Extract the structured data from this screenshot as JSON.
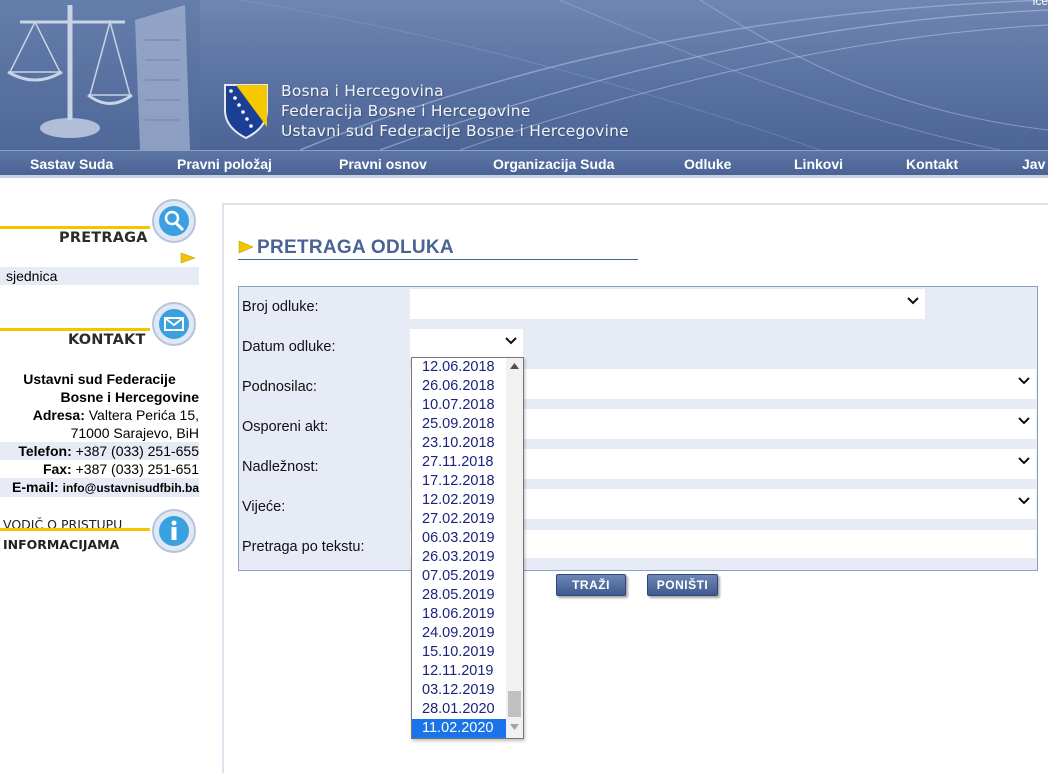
{
  "header": {
    "corner_text": "ice",
    "court_lines": [
      "Bosna i Hercegovina",
      "Federacija Bosne i Hercegovine",
      "Ustavni sud Federacije Bosne i Hercegovine"
    ]
  },
  "nav": {
    "items": [
      "Sastav Suda",
      "Pravni položaj",
      "Pravni osnov",
      "Organizacija Suda",
      "Odluke",
      "Linkovi",
      "Kontakt",
      "Jav"
    ]
  },
  "sidebar": {
    "search_heading": "PRETRAGA",
    "search_link": "sjednica",
    "contact_heading": "KONTAKT",
    "contact": {
      "org_line1": "Ustavni sud Federacije",
      "org_line2": "Bosne i Hercegovine",
      "address_label": "Adresa:",
      "address_line1": "Valtera Perića 15,",
      "address_line2": "71000 Sarajevo, BiH",
      "phone_label": "Telefon:",
      "phone": "+387 (033) 251-655",
      "fax_label": "Fax:",
      "fax": "+387 (033) 251-651",
      "email_label": "E-mail:",
      "email": "info@ustavnisudfbih.ba"
    },
    "guide_line1": "VODIČ O PRISTUPU",
    "guide_line2": "INFORMACIJAMA"
  },
  "main": {
    "title": "PRETRAGA ODLUKA",
    "fields": {
      "broj_odluke": "Broj odluke:",
      "datum_odluke": "Datum odluke:",
      "podnosilac": "Podnosilac:",
      "osporeni_akt": "Osporeni akt:",
      "nadleznost": "Nadležnost:",
      "vijece": "Vijeće:",
      "pretraga_po_tekstu": "Pretraga po tekstu:"
    },
    "search_button": "TRAŽI",
    "reset_button": "PONIŠTI"
  },
  "dropdown": {
    "options": [
      "12.06.2018",
      "26.06.2018",
      "10.07.2018",
      "25.09.2018",
      "23.10.2018",
      "27.11.2018",
      "17.12.2018",
      "12.02.2019",
      "27.02.2019",
      "06.03.2019",
      "26.03.2019",
      "07.05.2019",
      "28.05.2019",
      "18.06.2019",
      "24.09.2019",
      "15.10.2019",
      "12.11.2019",
      "03.12.2019",
      "28.01.2020",
      "11.02.2020"
    ],
    "selected": "11.02.2020"
  },
  "colors": {
    "header_blue": "#5a72a2",
    "accent_yellow": "#f2c500",
    "title_blue": "#4a6394",
    "panel_bg": "#e6ebf5",
    "selected_option": "#1a73e8"
  }
}
